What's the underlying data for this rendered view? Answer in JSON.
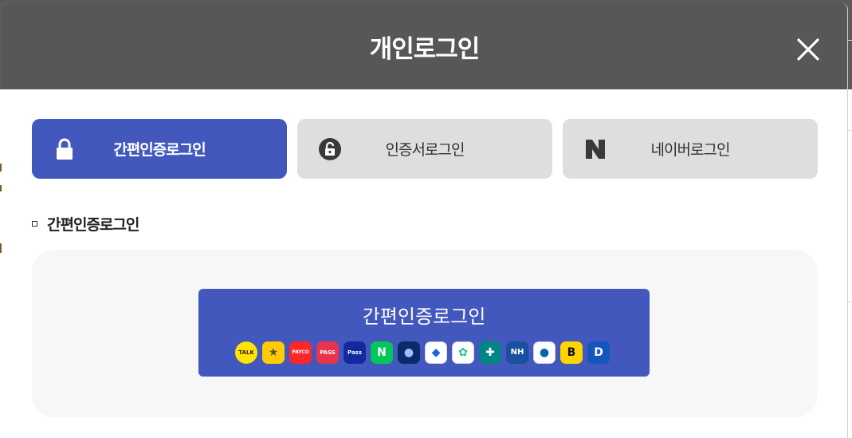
{
  "modal": {
    "title": "개인로그인"
  },
  "tabs": [
    {
      "label": "간편인증로그인",
      "icon": "lock-icon",
      "active": true
    },
    {
      "label": "인증서로그인",
      "icon": "certificate-icon",
      "active": false
    },
    {
      "label": "네이버로그인",
      "icon": "naver-icon",
      "active": false
    }
  ],
  "section": {
    "title": "간편인증로그인"
  },
  "simple_auth": {
    "button_label": "간편인증로그인",
    "providers": [
      {
        "name": "kakao-talk",
        "glyph": "TALK",
        "bg": "#fee500",
        "fg": "#3c1e1e"
      },
      {
        "name": "kb",
        "glyph": "★",
        "bg": "#ffcc00",
        "fg": "#5a4a2a"
      },
      {
        "name": "payco",
        "glyph": "PAYCO",
        "bg": "#fa2828",
        "fg": "#ffffff"
      },
      {
        "name": "pass",
        "glyph": "PASS",
        "bg": "#e8344e",
        "fg": "#ffffff"
      },
      {
        "name": "samsung-pass",
        "glyph": "Pass",
        "bg": "#1428a0",
        "fg": "#ffffff"
      },
      {
        "name": "naver",
        "glyph": "N",
        "bg": "#03c75a",
        "fg": "#ffffff"
      },
      {
        "name": "shinhan",
        "glyph": "●",
        "bg": "#0b2a6b",
        "fg": "#9ec0ff"
      },
      {
        "name": "toss",
        "glyph": "◆",
        "bg": "#ffffff",
        "fg": "#1b64da"
      },
      {
        "name": "banksalad",
        "glyph": "✿",
        "bg": "#ffffff",
        "fg": "#1ec28b"
      },
      {
        "name": "hana",
        "glyph": "✚",
        "bg": "#008485",
        "fg": "#ffffff"
      },
      {
        "name": "nh",
        "glyph": "NH",
        "bg": "#1b4fa0",
        "fg": "#ffffff"
      },
      {
        "name": "woori",
        "glyph": "●",
        "bg": "#ffffff",
        "fg": "#0067ac"
      },
      {
        "name": "kbank",
        "glyph": "B",
        "bg": "#ffd400",
        "fg": "#111111"
      },
      {
        "name": "d-auth",
        "glyph": "D",
        "bg": "#1555c0",
        "fg": "#ffffff"
      }
    ]
  },
  "colors": {
    "header_bg": "#575856",
    "accent": "#4258bd",
    "tab_inactive": "#dedede",
    "panel_bg": "#f7f7f7"
  }
}
